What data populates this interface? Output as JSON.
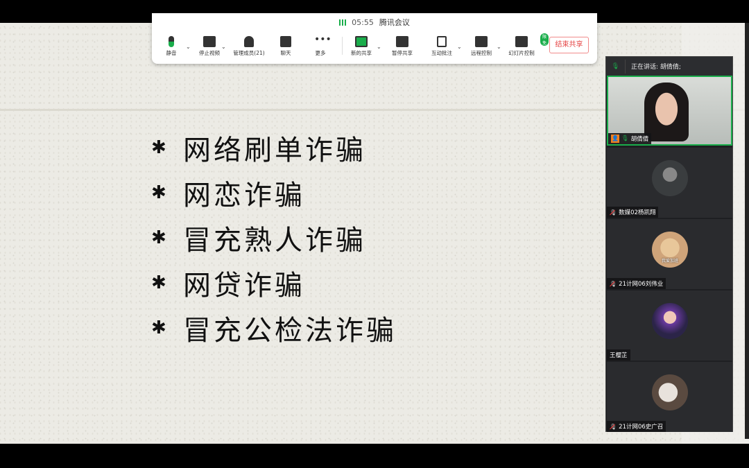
{
  "toolbar": {
    "time": "05:55",
    "app_title": "腾讯会议",
    "buttons": [
      {
        "label": "静音",
        "icon": "microphone-icon"
      },
      {
        "label": "停止视频",
        "icon": "video-camera-icon"
      },
      {
        "label": "管理成员(21)",
        "icon": "members-icon"
      },
      {
        "label": "聊天",
        "icon": "chat-icon"
      },
      {
        "label": "更多",
        "icon": "more-icon"
      },
      {
        "label": "新的共享",
        "icon": "new-share-icon"
      },
      {
        "label": "暂停共享",
        "icon": "pause-share-icon"
      },
      {
        "label": "互动批注",
        "icon": "annotate-icon"
      },
      {
        "label": "远程控制",
        "icon": "remote-control-icon"
      },
      {
        "label": "幻灯片控制",
        "icon": "slide-control-icon",
        "badge": "限免"
      }
    ],
    "end_share": "结束共享"
  },
  "slide": {
    "bullets": [
      "网络刷单诈骗",
      "网恋诈骗",
      "冒充熟人诈骗",
      "网贷诈骗",
      "冒充公检法诈骗"
    ]
  },
  "panel": {
    "speaking": "正在讲话: 胡倩倩;",
    "participants": [
      {
        "name": "胡倩倩",
        "video": true,
        "muted": false,
        "host": true
      },
      {
        "name": "数媒02杨凯翔",
        "muted": true
      },
      {
        "name": "21计网06刘伟业",
        "muted": true,
        "avatar_text": "我爱加班"
      },
      {
        "name": "王樱芷",
        "muted": false
      },
      {
        "name": "21计网06史广召",
        "muted": true
      }
    ]
  },
  "colors": {
    "accent": "#1aad4b",
    "end_share": "#e54545"
  }
}
